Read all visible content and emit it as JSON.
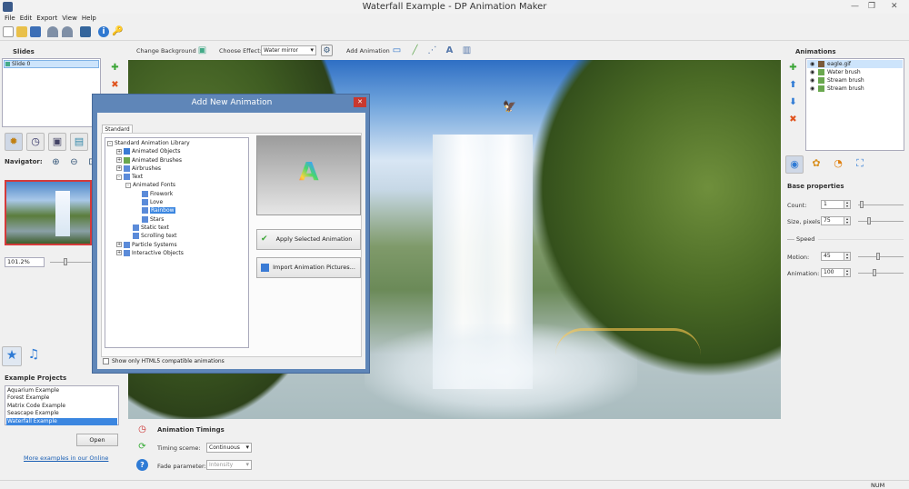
{
  "window": {
    "title": "Waterfall Example - DP Animation Maker"
  },
  "menu": [
    "File",
    "Edit",
    "Export",
    "View",
    "Help"
  ],
  "slides": {
    "header": "Slides",
    "items": [
      "Slide 0"
    ]
  },
  "navigator": {
    "header": "Navigator:",
    "zoom": "101.2%"
  },
  "projects": {
    "header": "Example Projects",
    "items": [
      "Aquarium Example",
      "Forest Example",
      "Matrix Code Example",
      "Seascape Example",
      "Waterfall Example"
    ],
    "selected_index": 4,
    "open_label": "Open",
    "more_link": "More examples in our Online"
  },
  "canvas_toolbar": {
    "change_bg": "Change Background",
    "choose_effect": "Choose Effect:",
    "effect_value": "Water mirror",
    "add_animation": "Add Animation"
  },
  "timings": {
    "header": "Animation Timings",
    "timing_label": "Timing sceme:",
    "timing_value": "Continuous",
    "fade_label": "Fade parameter:",
    "fade_value": "Intensity"
  },
  "animations": {
    "header": "Animations",
    "items": [
      "eagle.gif",
      "Water brush",
      "Stream brush",
      "Stream brush"
    ],
    "selected_index": 0
  },
  "base": {
    "header": "Base properties",
    "count_label": "Count:",
    "count_value": "1",
    "size_label": "Size, pixels:",
    "size_value": "75",
    "speed_label": "Speed",
    "motion_label": "Motion:",
    "motion_value": "45",
    "anim_label": "Animation:",
    "anim_value": "100"
  },
  "dialog": {
    "title": "Add New Animation",
    "tab": "Standard",
    "apply": "Apply Selected Animation",
    "import": "Import Animation Pictures...",
    "html5": "Show only HTML5 compatible animations",
    "tree": [
      {
        "label": "Standard Animation Library",
        "level": 0,
        "pm": "-",
        "icon": ""
      },
      {
        "label": "Animated Objects",
        "level": 1,
        "pm": "+",
        "icon": "#3a7bd5"
      },
      {
        "label": "Animated Brushes",
        "level": 1,
        "pm": "+",
        "icon": "#6aa84f"
      },
      {
        "label": "Airbrushes",
        "level": 1,
        "pm": "+",
        "icon": "#5b8bd9"
      },
      {
        "label": "Text",
        "level": 1,
        "pm": "-",
        "icon": "#5b8bd9"
      },
      {
        "label": "Animated Fonts",
        "level": 2,
        "pm": "-",
        "icon": ""
      },
      {
        "label": "Firework",
        "level": 3,
        "pm": "",
        "icon": "#5b8bd9"
      },
      {
        "label": "Love",
        "level": 3,
        "pm": "",
        "icon": "#5b8bd9"
      },
      {
        "label": "Rainbow",
        "level": 3,
        "pm": "",
        "icon": "#5b8bd9",
        "selected": true
      },
      {
        "label": "Stars",
        "level": 3,
        "pm": "",
        "icon": "#5b8bd9"
      },
      {
        "label": "Static text",
        "level": 2,
        "pm": "",
        "icon": "#5b8bd9"
      },
      {
        "label": "Scrolling text",
        "level": 2,
        "pm": "",
        "icon": "#5b8bd9"
      },
      {
        "label": "Particle Systems",
        "level": 1,
        "pm": "+",
        "icon": "#5b8bd9"
      },
      {
        "label": "Interactive Objects",
        "level": 1,
        "pm": "+",
        "icon": "#5b8bd9"
      }
    ],
    "preview_glyph": "A"
  },
  "status": {
    "num": "NUM"
  }
}
